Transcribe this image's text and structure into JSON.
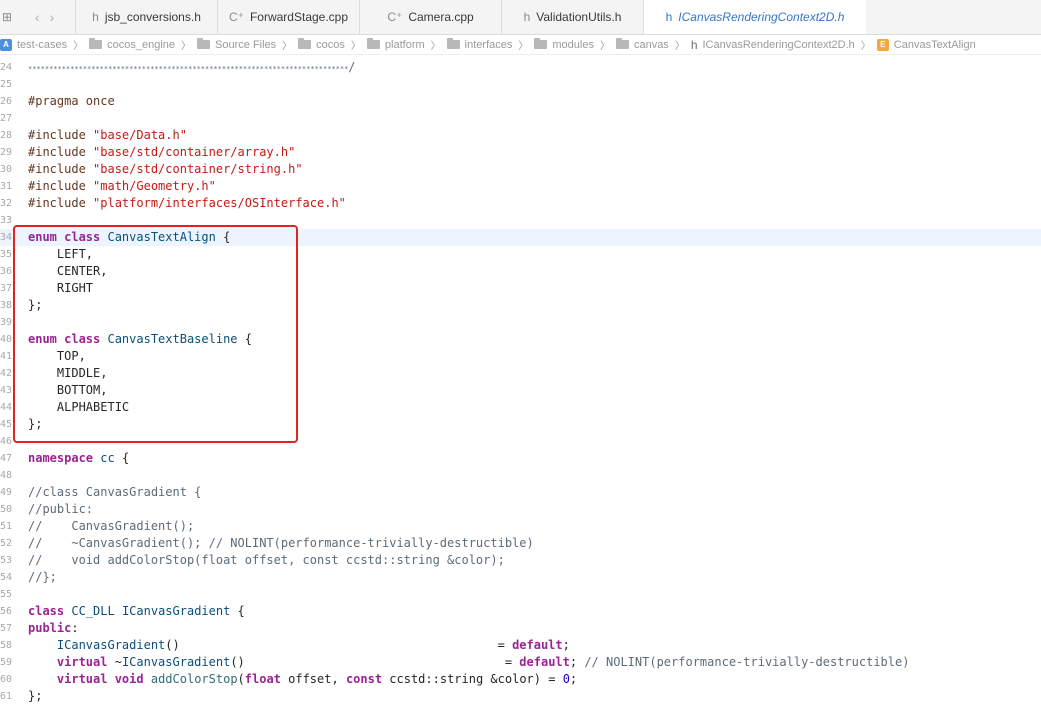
{
  "tabs": [
    {
      "icon": "h",
      "label": "jsb_conversions.h",
      "active": false
    },
    {
      "icon": "C⁺",
      "label": "ForwardStage.cpp",
      "active": false
    },
    {
      "icon": "C⁺",
      "label": "Camera.cpp",
      "active": false
    },
    {
      "icon": "h",
      "label": "ValidationUtils.h",
      "active": false
    },
    {
      "icon": "h",
      "label": "ICanvasRenderingContext2D.h",
      "active": true
    }
  ],
  "breadcrumb": {
    "project": "test-cases",
    "folders": [
      "cocos_engine",
      "Source Files",
      "cocos",
      "platform",
      "interfaces",
      "modules",
      "canvas"
    ],
    "file": "ICanvasRenderingContext2D.h",
    "symbol": "CanvasTextAlign"
  },
  "code": {
    "lines": [
      {
        "n": "24",
        "html": "<span class=\"stars\">****************************************************************************</span><span class=\"cm\">/</span>"
      },
      {
        "n": "25",
        "html": ""
      },
      {
        "n": "26",
        "html": "<span class=\"pp\">#pragma once</span>"
      },
      {
        "n": "27",
        "html": ""
      },
      {
        "n": "28",
        "html": "<span class=\"pp\">#include </span><span class=\"str\">\"base/Data.h\"</span>"
      },
      {
        "n": "29",
        "html": "<span class=\"pp\">#include </span><span class=\"str\">\"base/std/container/array.h\"</span>"
      },
      {
        "n": "30",
        "html": "<span class=\"pp\">#include </span><span class=\"str\">\"base/std/container/string.h\"</span>"
      },
      {
        "n": "31",
        "html": "<span class=\"pp\">#include </span><span class=\"str\">\"math/Geometry.h\"</span>"
      },
      {
        "n": "32",
        "html": "<span class=\"pp\">#include </span><span class=\"str\">\"platform/interfaces/OSInterface.h\"</span>"
      },
      {
        "n": "33",
        "html": ""
      },
      {
        "n": "34",
        "html": "<span class=\"kw\">enum class</span> <span class=\"ty\">CanvasTextAlign</span> {",
        "current": true
      },
      {
        "n": "35",
        "html": "    LEFT,"
      },
      {
        "n": "36",
        "html": "    CENTER,"
      },
      {
        "n": "37",
        "html": "    RIGHT"
      },
      {
        "n": "38",
        "html": "};"
      },
      {
        "n": "39",
        "html": ""
      },
      {
        "n": "40",
        "html": "<span class=\"kw\">enum class</span> <span class=\"ty\">CanvasTextBaseline</span> {"
      },
      {
        "n": "41",
        "html": "    TOP,"
      },
      {
        "n": "42",
        "html": "    MIDDLE,"
      },
      {
        "n": "43",
        "html": "    BOTTOM,"
      },
      {
        "n": "44",
        "html": "    ALPHABETIC"
      },
      {
        "n": "45",
        "html": "};"
      },
      {
        "n": "46",
        "html": ""
      },
      {
        "n": "47",
        "html": "<span class=\"kw\">namespace</span> <span class=\"ty\">cc</span> {"
      },
      {
        "n": "48",
        "html": ""
      },
      {
        "n": "49",
        "html": "<span class=\"cm\">//class CanvasGradient {</span>"
      },
      {
        "n": "50",
        "html": "<span class=\"cm\">//public:</span>"
      },
      {
        "n": "51",
        "html": "<span class=\"cm\">//    CanvasGradient();</span>"
      },
      {
        "n": "52",
        "html": "<span class=\"cm\">//    ~CanvasGradient(); // NOLINT(performance-trivially-destructible)</span>"
      },
      {
        "n": "53",
        "html": "<span class=\"cm\">//    void addColorStop(float offset, const ccstd::string &amp;color);</span>"
      },
      {
        "n": "54",
        "html": "<span class=\"cm\">//};</span>"
      },
      {
        "n": "55",
        "html": ""
      },
      {
        "n": "56",
        "html": "<span class=\"kw\">class</span> <span class=\"ty\">CC_DLL</span> <span class=\"ty\">ICanvasGradient</span> {"
      },
      {
        "n": "57",
        "html": "<span class=\"kw\">public</span>:"
      },
      {
        "n": "58",
        "html": "    <span class=\"ty\">ICanvasGradient</span>()                                            = <span class=\"kw\">default</span>;"
      },
      {
        "n": "59",
        "html": "    <span class=\"kw\">virtual</span> ~<span class=\"ty\">ICanvasGradient</span>()                                    = <span class=\"kw\">default</span>; <span class=\"cm\">// NOLINT(performance-trivially-destructible)</span>"
      },
      {
        "n": "60",
        "html": "    <span class=\"kw\">virtual void</span> <span class=\"fn\">addColorStop</span>(<span class=\"kw\">float</span> offset, <span class=\"kw\">const</span> ccstd::string &amp;color) = <span class=\"num\">0</span>;"
      },
      {
        "n": "61",
        "html": "};"
      }
    ]
  }
}
